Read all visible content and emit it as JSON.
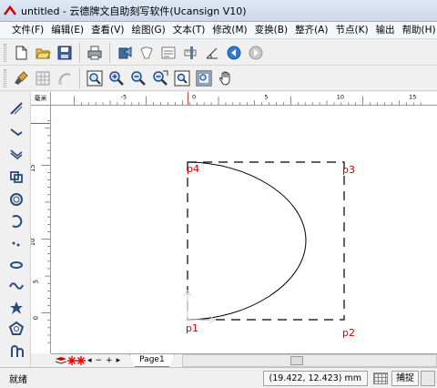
{
  "window": {
    "title": "untitled - 云德牌文自助刻写软件(Ucansign V10)"
  },
  "menu": [
    "文件(F)",
    "编辑(E)",
    "查看(V)",
    "绘图(G)",
    "文本(T)",
    "修改(M)",
    "变换(B)",
    "整齐(A)",
    "节点(K)",
    "输出",
    "帮助(H)"
  ],
  "ruler": {
    "unit": "毫米",
    "h_labels": [
      "-5",
      "0",
      "5",
      "10",
      "15"
    ],
    "v_labels": [
      "15",
      "10",
      "5",
      "0"
    ]
  },
  "canvas": {
    "point_labels": [
      "p1",
      "p2",
      "p3",
      "p4"
    ],
    "shape": "semicircle-arc",
    "bbox_style": "dashed"
  },
  "tabs": {
    "page1": "Page1",
    "controls": [
      "◂",
      "−",
      "+",
      "▸"
    ]
  },
  "status": {
    "left": "就绪",
    "coords": "(19.422,   12.423) mm",
    "snap": "捕捉"
  },
  "colors": {
    "accent": "#cc0000",
    "ruler_red": "#cc0000"
  }
}
